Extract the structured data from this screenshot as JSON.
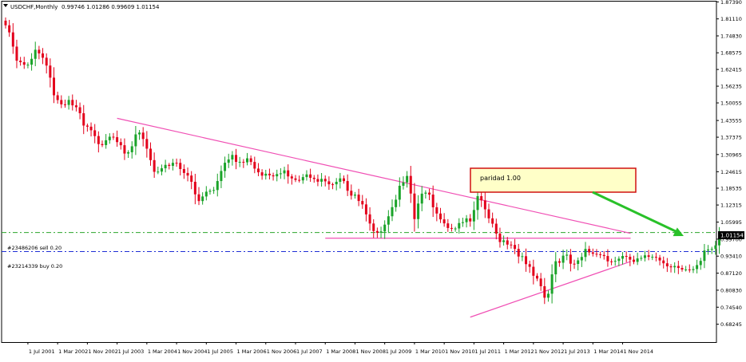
{
  "window": {
    "title": "USDCHF,Monthly",
    "ohlc": "0.99746 1.01286 0.99609 1.01154"
  },
  "colors": {
    "background": "#ffffff",
    "frame": "#000000",
    "bull_candle": "#1aa329",
    "bear_candle": "#e3001b",
    "trendline": "#f04fb4",
    "sell_line": "#2ba52b",
    "buy_line": "#1e2ed6",
    "arrow": "#29c129",
    "note_bg": "#ffffc8",
    "note_border": "#d01010"
  },
  "chart_data": {
    "type": "candlestick",
    "symbol": "USDCHF",
    "timeframe": "Monthly",
    "current_price": "1.01154",
    "ylim": [
      0.6165,
      1.875
    ],
    "y_ticks": [
      "1.87390",
      "1.81110",
      "1.74830",
      "1.68575",
      "1.62415",
      "1.56235",
      "1.50055",
      "1.43555",
      "1.37375",
      "1.30965",
      "1.24615",
      "1.18535",
      "1.12315",
      "1.05995",
      "0.99700",
      "0.93410",
      "0.87120",
      "0.80830",
      "0.74540",
      "0.68245"
    ],
    "y_tick_values": [
      1.8739,
      1.8111,
      1.7483,
      1.68575,
      1.62415,
      1.56235,
      1.50055,
      1.43555,
      1.37375,
      1.30965,
      1.24615,
      1.18535,
      1.12315,
      1.05995,
      0.997,
      0.9341,
      0.8712,
      0.8083,
      0.7454,
      0.68245
    ],
    "x_ticks": [
      "1 Jul 2001",
      "1 Mar 2002",
      "1 Nov 2002",
      "1 Jul 2003",
      "1 Mar 2004",
      "1 Nov 2004",
      "1 Jul 2005",
      "1 Mar 2006",
      "1 Nov 2006",
      "1 Jul 2007",
      "1 Mar 2008",
      "1 Nov 2008",
      "1 Jul 2009",
      "1 Mar 2010",
      "1 Nov 2010",
      "1 Jul 2011",
      "1 Mar 2012",
      "1 Nov 2012",
      "1 Jul 2013",
      "1 Mar 2014",
      "1 Nov 2014"
    ],
    "grid": false,
    "closes": [
      1.7874,
      1.7612,
      1.7086,
      1.6566,
      1.651,
      1.6416,
      1.6418,
      1.6635,
      1.697,
      1.6834,
      1.6675,
      1.6386,
      1.5939,
      1.5287,
      1.5111,
      1.4952,
      1.4931,
      1.5115,
      1.4915,
      1.4845,
      1.4623,
      1.4168,
      1.4127,
      1.3993,
      1.3779,
      1.3483,
      1.3446,
      1.3625,
      1.3755,
      1.3738,
      1.3556,
      1.3441,
      1.3134,
      1.3181,
      1.3402,
      1.3842,
      1.3908,
      1.3671,
      1.3313,
      1.289,
      1.2458,
      1.2466,
      1.2589,
      1.2715,
      1.2679,
      1.2791,
      1.2789,
      1.2561,
      1.2416,
      1.232,
      1.209,
      1.1626,
      1.1377,
      1.1547,
      1.1724,
      1.1759,
      1.1785,
      1.2117,
      1.2489,
      1.2794,
      1.2915,
      1.3082,
      1.2825,
      1.2827,
      1.2809,
      1.2957,
      1.2823,
      1.2577,
      1.244,
      1.2316,
      1.2387,
      1.2329,
      1.2292,
      1.2375,
      1.2401,
      1.2512,
      1.2288,
      1.2214,
      1.2159,
      1.2142,
      1.2263,
      1.2362,
      1.2239,
      1.2192,
      1.2093,
      1.2197,
      1.2106,
      1.1998,
      1.1997,
      1.2089,
      1.2216,
      1.2116,
      1.1758,
      1.1578,
      1.1615,
      1.1379,
      1.1254,
      1.0885,
      1.0547,
      1.0268,
      1.0206,
      1.0256,
      1.0506,
      1.0815,
      1.1152,
      1.1428,
      1.1942,
      1.2068,
      1.2306,
      1.1655,
      1.0711,
      1.1285,
      1.1651,
      1.1689,
      1.1617,
      1.1147,
      1.0916,
      1.0701,
      1.0553,
      1.0382,
      1.0355,
      1.0364,
      1.0564,
      1.0596,
      1.0737,
      1.0624,
      1.1047,
      1.1558,
      1.1402,
      1.1071,
      1.0738,
      1.0541,
      1.0175,
      0.9862,
      0.9924,
      0.9768,
      0.9756,
      0.9609,
      0.9327,
      0.9339,
      0.9045,
      0.8948,
      0.8616,
      0.8513,
      0.8229,
      0.7805,
      0.7952,
      0.8668,
      0.9153,
      0.9098,
      0.9359,
      0.9395,
      0.9062,
      0.9053,
      0.9186,
      0.9311,
      0.9607,
      0.9482,
      0.9429,
      0.9411,
      0.9383,
      0.9346,
      0.9149,
      0.9147,
      0.9166,
      0.9247,
      0.9348,
      0.9318,
      0.9211,
      0.913,
      0.9256,
      0.9275,
      0.9371,
      0.9316,
      0.9316,
      0.9288,
      0.9181,
      0.9077,
      0.8964,
      0.8929,
      0.8977,
      0.8905,
      0.8846,
      0.8848,
      0.8826,
      0.8863,
      0.9011,
      0.9166,
      0.9549,
      0.9586,
      0.9608,
      0.9739,
      1.0115
    ],
    "first_open": 1.8045,
    "trendlines": [
      {
        "from": [
          "1 Jul 2003",
          1.4436
        ],
        "to": [
          "1 Nov 2014",
          1.0185
        ]
      },
      {
        "from": [
          "1 Jun 2011",
          0.7086
        ],
        "to": [
          "1 Nov 2014",
          0.9143
        ]
      },
      {
        "from": [
          "1 Mar 2008",
          1.0004
        ],
        "to": [
          "1 Nov 2014",
          1.0004
        ]
      }
    ],
    "order_lines": [
      {
        "label": "#23486206 sell 0.20",
        "price": 1.0215,
        "style": "dashdot",
        "color": "#2ba52b"
      },
      {
        "label": "#23214339 buy 0.20",
        "price": 0.9511,
        "style": "dashdot",
        "color": "#1e2ed6"
      }
    ],
    "annotation": {
      "text": "paridad 1.00"
    }
  }
}
